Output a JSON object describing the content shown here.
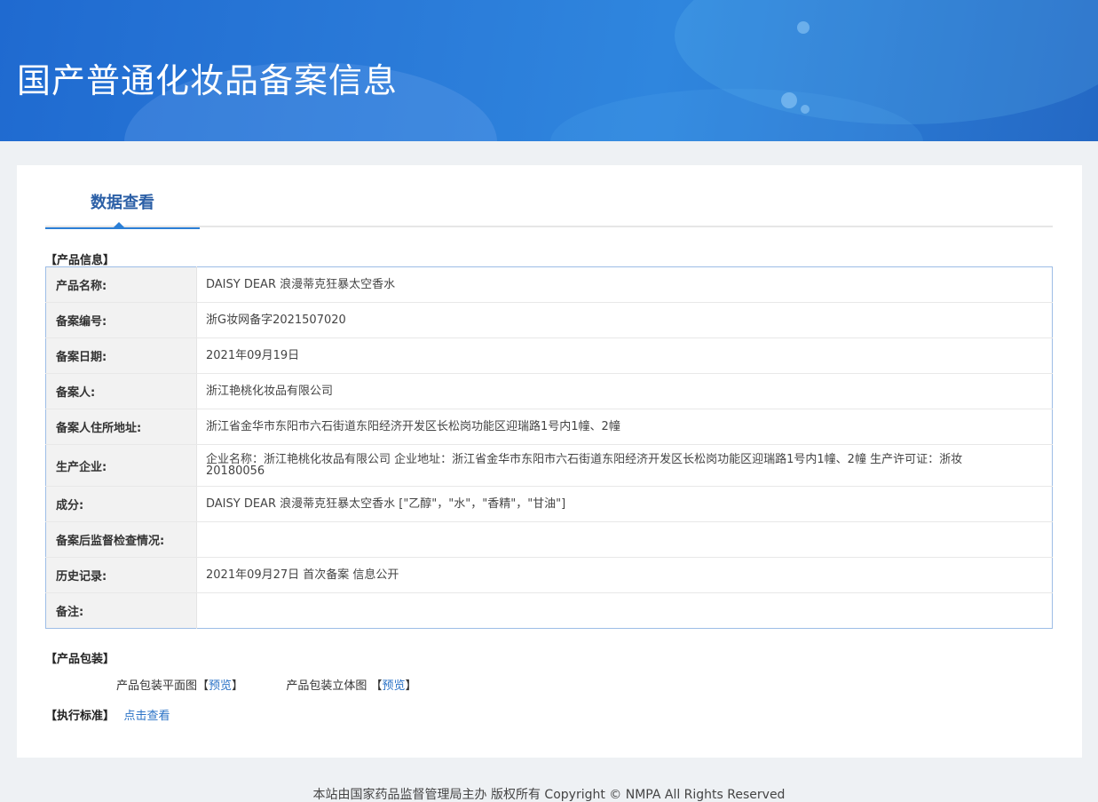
{
  "banner": {
    "title": "国产普通化妆品备案信息"
  },
  "tabs": [
    {
      "label": "数据查看"
    }
  ],
  "product_info": {
    "section_title": "【产品信息】",
    "rows": [
      {
        "label": "产品名称:",
        "value": "DAISY DEAR 浪漫蒂克狂暴太空香水"
      },
      {
        "label": "备案编号:",
        "value": "浙G妆网备字2021507020"
      },
      {
        "label": "备案日期:",
        "value": "2021年09月19日"
      },
      {
        "label": "备案人:",
        "value": "浙江艳桃化妆品有限公司"
      },
      {
        "label": "备案人住所地址:",
        "value": "浙江省金华市东阳市六石街道东阳经济开发区长松岗功能区迎瑞路1号内1幢、2幢"
      },
      {
        "label": "生产企业:",
        "value": "企业名称：浙江艳桃化妆品有限公司 企业地址：浙江省金华市东阳市六石街道东阳经济开发区长松岗功能区迎瑞路1号内1幢、2幢 生产许可证：浙妆20180056"
      },
      {
        "label": "成分:",
        "value": "DAISY DEAR 浪漫蒂克狂暴太空香水 [\"乙醇\"，\"水\"，\"香精\"，\"甘油\"]"
      },
      {
        "label": "备案后监督检查情况:",
        "value": ""
      },
      {
        "label": "历史记录:",
        "value": "2021年09月27日 首次备案 信息公开"
      },
      {
        "label": "备注:",
        "value": ""
      }
    ]
  },
  "packaging": {
    "section_title": "【产品包装】",
    "flat_label": "产品包装平面图",
    "flat_open": "【",
    "flat_link": "预览",
    "flat_close": "】",
    "solid_label": "产品包装立体图",
    "solid_open": "【",
    "solid_link": "预览",
    "solid_close": "】"
  },
  "standard": {
    "section_title": "【执行标准】",
    "link": "点击查看"
  },
  "footer": {
    "text": "本站由国家药品监督管理局主办 版权所有 Copyright © NMPA All Rights Reserved"
  },
  "colors": {
    "banner": "#2a7ad8",
    "accent": "#2b7fd6",
    "link": "#2a72c6",
    "tab_text": "#2b5fa6"
  }
}
